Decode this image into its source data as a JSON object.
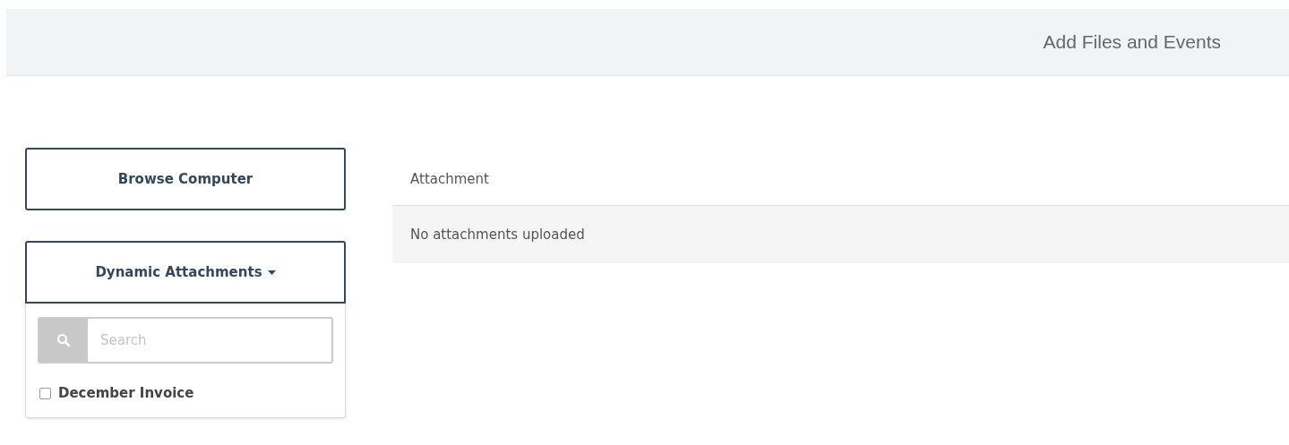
{
  "header": {
    "title": "Add Files and Events"
  },
  "browse_button": {
    "label": "Browse Computer"
  },
  "dynamic_dropdown": {
    "label": "Dynamic Attachments",
    "expanded": true,
    "search": {
      "placeholder": "Search"
    },
    "items": [
      {
        "label": "December Invoice",
        "checked": false
      }
    ]
  },
  "table": {
    "columns": [
      "Attachment"
    ],
    "empty_message": "No attachments uploaded"
  }
}
